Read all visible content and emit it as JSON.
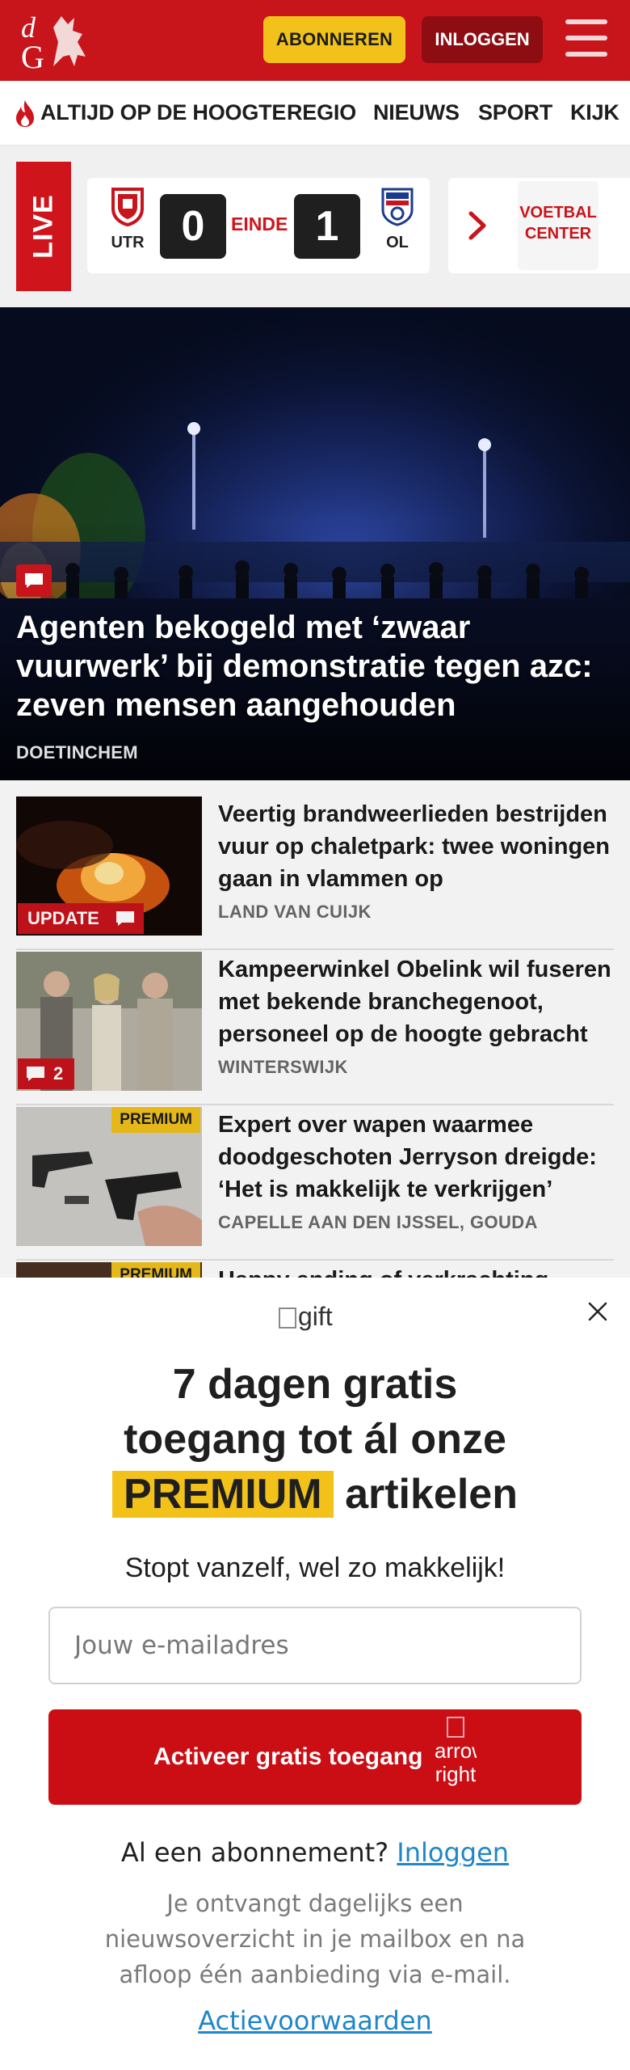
{
  "header": {
    "logo_text": "dG",
    "subscribe_label": "ABONNEREN",
    "login_label": "INLOGGEN"
  },
  "nav": {
    "items": [
      "ALTIJD OP DE HOOGTE",
      "REGIO",
      "NIEUWS",
      "SPORT",
      "KIJK"
    ]
  },
  "live": {
    "tag": "LIVE",
    "home_team": "UTR",
    "away_team": "OL",
    "home_score": "0",
    "away_score": "1",
    "status": "EINDE",
    "voetbal_center": "VOETBAL CENTER"
  },
  "hero": {
    "title": "Agenten bekogeld met ‘zwaar vuurwerk’ bij demonstratie tegen azc: zeven mensen aangehouden",
    "location": "DOETINCHEM"
  },
  "articles": [
    {
      "title": "Veertig brandweerlieden bestrijden vuur op chaletpark: twee woningen gaan in vlammen op",
      "location": "LAND VAN CUIJK",
      "badge": "UPDATE"
    },
    {
      "title": "Kampeerwinkel Obelink wil fuseren met bekende branche­genoot, personeel op de hoogte gebracht",
      "location": "WINTERSWIJK",
      "comments": "2"
    },
    {
      "title": "Expert over wapen waarmee doodgeschoten Jerryson dreigde: ‘Het is makkelijk te verkrijgen’",
      "location": "CAPELLE AAN DEN IJSSEL, GOUDA",
      "badge": "PREMIUM"
    },
    {
      "title": "Happy ending of verkrachting",
      "badge": "PREMIUM"
    }
  ],
  "modal": {
    "gift_alt": "gift",
    "title_line1": "7 dagen gratis",
    "title_line2": "toegang tot ál onze",
    "title_premium": "PREMIUM",
    "title_end": "artikelen",
    "subtitle": "Stopt vanzelf, wel zo makkelijk!",
    "email_placeholder": "Jouw e-mailadres",
    "cta_label": "Activeer gratis toegang",
    "cta_icon_alt": "arrow-right",
    "have_sub": "Al een abonnement?",
    "login_link": "Inloggen",
    "info": "Je ontvangt dagelijks een nieuwsoverzicht in je mailbox en na afloop één aanbieding via e-mail.",
    "terms_link": "Actievoorwaarden"
  },
  "colors": {
    "brand_red": "#c8141b",
    "premium_yellow": "#f2c21b",
    "link_blue": "#1f86c8"
  }
}
